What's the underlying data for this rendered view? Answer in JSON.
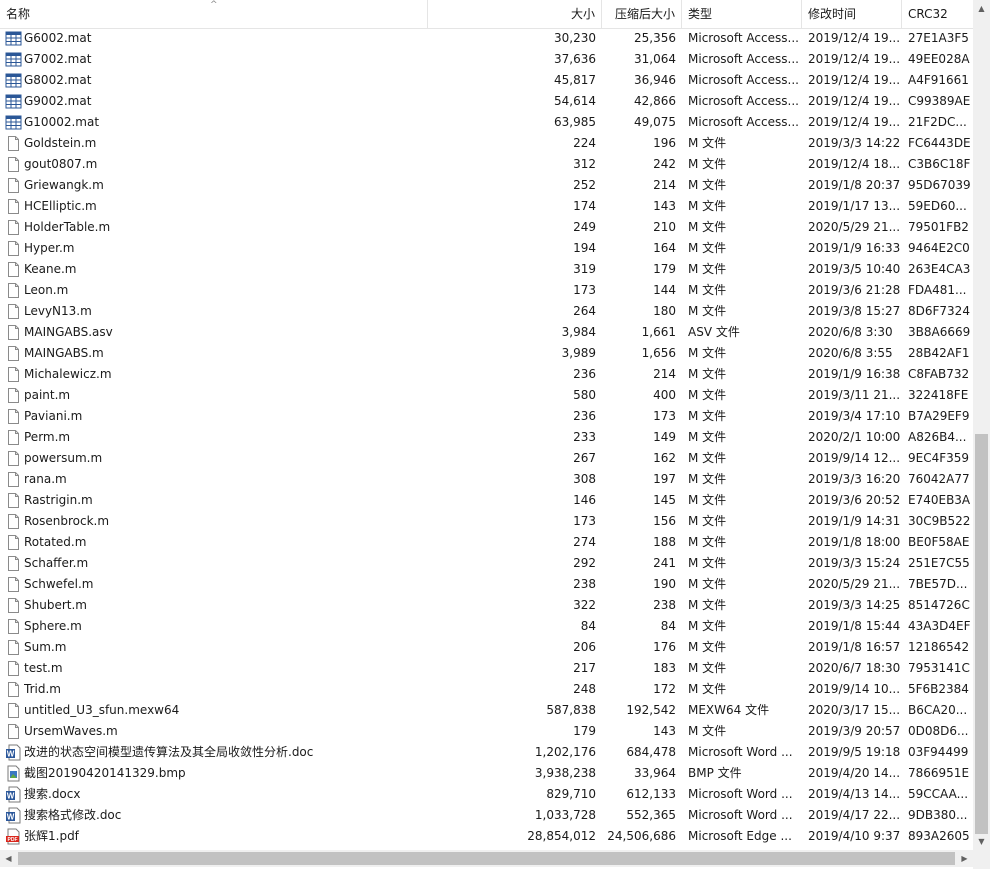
{
  "columns": {
    "name": "名称",
    "size": "大小",
    "compressed": "压缩后大小",
    "type": "类型",
    "modified": "修改时间",
    "crc": "CRC32"
  },
  "icons": {
    "scroll_up": "▲",
    "scroll_down": "▼",
    "scroll_left": "◀",
    "scroll_right": "▶",
    "sort": "^"
  },
  "files": [
    {
      "name": "G6002.mat",
      "size": "30,230",
      "compressed": "25,356",
      "type": "Microsoft Access...",
      "modified": "2019/12/4 19...",
      "crc": "27E1A3F5",
      "icon": "access-table-icon"
    },
    {
      "name": "G7002.mat",
      "size": "37,636",
      "compressed": "31,064",
      "type": "Microsoft Access...",
      "modified": "2019/12/4 19...",
      "crc": "49EE028A",
      "icon": "access-table-icon"
    },
    {
      "name": "G8002.mat",
      "size": "45,817",
      "compressed": "36,946",
      "type": "Microsoft Access...",
      "modified": "2019/12/4 19...",
      "crc": "A4F91661",
      "icon": "access-table-icon"
    },
    {
      "name": "G9002.mat",
      "size": "54,614",
      "compressed": "42,866",
      "type": "Microsoft Access...",
      "modified": "2019/12/4 19...",
      "crc": "C99389AE",
      "icon": "access-table-icon"
    },
    {
      "name": "G10002.mat",
      "size": "63,985",
      "compressed": "49,075",
      "type": "Microsoft Access...",
      "modified": "2019/12/4 19...",
      "crc": "21F2DC...",
      "icon": "access-table-icon"
    },
    {
      "name": "Goldstein.m",
      "size": "224",
      "compressed": "196",
      "type": "M 文件",
      "modified": "2019/3/3 14:22",
      "crc": "FC6443DE",
      "icon": "file-icon"
    },
    {
      "name": "gout0807.m",
      "size": "312",
      "compressed": "242",
      "type": "M 文件",
      "modified": "2019/12/4 18...",
      "crc": "C3B6C18F",
      "icon": "file-icon"
    },
    {
      "name": "Griewangk.m",
      "size": "252",
      "compressed": "214",
      "type": "M 文件",
      "modified": "2019/1/8 20:37",
      "crc": "95D67039",
      "icon": "file-icon"
    },
    {
      "name": "HCElliptic.m",
      "size": "174",
      "compressed": "143",
      "type": "M 文件",
      "modified": "2019/1/17 13...",
      "crc": "59ED60...",
      "icon": "file-icon"
    },
    {
      "name": "HolderTable.m",
      "size": "249",
      "compressed": "210",
      "type": "M 文件",
      "modified": "2020/5/29 21...",
      "crc": "79501FB2",
      "icon": "file-icon"
    },
    {
      "name": "Hyper.m",
      "size": "194",
      "compressed": "164",
      "type": "M 文件",
      "modified": "2019/1/9 16:33",
      "crc": "9464E2C0",
      "icon": "file-icon"
    },
    {
      "name": "Keane.m",
      "size": "319",
      "compressed": "179",
      "type": "M 文件",
      "modified": "2019/3/5 10:40",
      "crc": "263E4CA3",
      "icon": "file-icon"
    },
    {
      "name": "Leon.m",
      "size": "173",
      "compressed": "144",
      "type": "M 文件",
      "modified": "2019/3/6 21:28",
      "crc": "FDA481...",
      "icon": "file-icon"
    },
    {
      "name": "LevyN13.m",
      "size": "264",
      "compressed": "180",
      "type": "M 文件",
      "modified": "2019/3/8 15:27",
      "crc": "8D6F7324",
      "icon": "file-icon"
    },
    {
      "name": "MAINGABS.asv",
      "size": "3,984",
      "compressed": "1,661",
      "type": "ASV 文件",
      "modified": "2020/6/8 3:30",
      "crc": "3B8A6669",
      "icon": "file-icon"
    },
    {
      "name": "MAINGABS.m",
      "size": "3,989",
      "compressed": "1,656",
      "type": "M 文件",
      "modified": "2020/6/8 3:55",
      "crc": "28B42AF1",
      "icon": "file-icon"
    },
    {
      "name": "Michalewicz.m",
      "size": "236",
      "compressed": "214",
      "type": "M 文件",
      "modified": "2019/1/9 16:38",
      "crc": "C8FAB732",
      "icon": "file-icon"
    },
    {
      "name": "paint.m",
      "size": "580",
      "compressed": "400",
      "type": "M 文件",
      "modified": "2019/3/11 21...",
      "crc": "322418FE",
      "icon": "file-icon"
    },
    {
      "name": "Paviani.m",
      "size": "236",
      "compressed": "173",
      "type": "M 文件",
      "modified": "2019/3/4 17:10",
      "crc": "B7A29EF9",
      "icon": "file-icon"
    },
    {
      "name": "Perm.m",
      "size": "233",
      "compressed": "149",
      "type": "M 文件",
      "modified": "2020/2/1 10:00",
      "crc": "A826B4...",
      "icon": "file-icon"
    },
    {
      "name": "powersum.m",
      "size": "267",
      "compressed": "162",
      "type": "M 文件",
      "modified": "2019/9/14 12...",
      "crc": "9EC4F359",
      "icon": "file-icon"
    },
    {
      "name": "rana.m",
      "size": "308",
      "compressed": "197",
      "type": "M 文件",
      "modified": "2019/3/3 16:20",
      "crc": "76042A77",
      "icon": "file-icon"
    },
    {
      "name": "Rastrigin.m",
      "size": "146",
      "compressed": "145",
      "type": "M 文件",
      "modified": "2019/3/6 20:52",
      "crc": "E740EB3A",
      "icon": "file-icon"
    },
    {
      "name": "Rosenbrock.m",
      "size": "173",
      "compressed": "156",
      "type": "M 文件",
      "modified": "2019/1/9 14:31",
      "crc": "30C9B522",
      "icon": "file-icon"
    },
    {
      "name": "Rotated.m",
      "size": "274",
      "compressed": "188",
      "type": "M 文件",
      "modified": "2019/1/8 18:00",
      "crc": "BE0F58AE",
      "icon": "file-icon"
    },
    {
      "name": "Schaffer.m",
      "size": "292",
      "compressed": "241",
      "type": "M 文件",
      "modified": "2019/3/3 15:24",
      "crc": "251E7C55",
      "icon": "file-icon"
    },
    {
      "name": "Schwefel.m",
      "size": "238",
      "compressed": "190",
      "type": "M 文件",
      "modified": "2020/5/29 21...",
      "crc": "7BE57D...",
      "icon": "file-icon"
    },
    {
      "name": "Shubert.m",
      "size": "322",
      "compressed": "238",
      "type": "M 文件",
      "modified": "2019/3/3 14:25",
      "crc": "8514726C",
      "icon": "file-icon"
    },
    {
      "name": "Sphere.m",
      "size": "84",
      "compressed": "84",
      "type": "M 文件",
      "modified": "2019/1/8 15:44",
      "crc": "43A3D4EF",
      "icon": "file-icon"
    },
    {
      "name": "Sum.m",
      "size": "206",
      "compressed": "176",
      "type": "M 文件",
      "modified": "2019/1/8 16:57",
      "crc": "12186542",
      "icon": "file-icon"
    },
    {
      "name": "test.m",
      "size": "217",
      "compressed": "183",
      "type": "M 文件",
      "modified": "2020/6/7 18:30",
      "crc": "7953141C",
      "icon": "file-icon"
    },
    {
      "name": "Trid.m",
      "size": "248",
      "compressed": "172",
      "type": "M 文件",
      "modified": "2019/9/14 10...",
      "crc": "5F6B2384",
      "icon": "file-icon"
    },
    {
      "name": "untitled_U3_sfun.mexw64",
      "size": "587,838",
      "compressed": "192,542",
      "type": "MEXW64 文件",
      "modified": "2020/3/17 15...",
      "crc": "B6CA20...",
      "icon": "file-icon"
    },
    {
      "name": "UrsemWaves.m",
      "size": "179",
      "compressed": "143",
      "type": "M 文件",
      "modified": "2019/3/9 20:57",
      "crc": "0D08D6...",
      "icon": "file-icon"
    },
    {
      "name": "改进的状态空间模型遗传算法及其全局收敛性分析.doc",
      "size": "1,202,176",
      "compressed": "684,478",
      "type": "Microsoft Word ...",
      "modified": "2019/9/5 19:18",
      "crc": "03F94499",
      "icon": "word-doc-icon"
    },
    {
      "name": "截图20190420141329.bmp",
      "size": "3,938,238",
      "compressed": "33,964",
      "type": "BMP 文件",
      "modified": "2019/4/20 14...",
      "crc": "7866951E",
      "icon": "bitmap-image-icon"
    },
    {
      "name": "搜索.docx",
      "size": "829,710",
      "compressed": "612,133",
      "type": "Microsoft Word ...",
      "modified": "2019/4/13 14...",
      "crc": "59CCAA...",
      "icon": "word-docx-icon"
    },
    {
      "name": "搜索格式修改.doc",
      "size": "1,033,728",
      "compressed": "552,365",
      "type": "Microsoft Word ...",
      "modified": "2019/4/17 22...",
      "crc": "9DB380...",
      "icon": "word-doc-icon"
    },
    {
      "name": "张辉1.pdf",
      "size": "28,854,012",
      "compressed": "24,506,686",
      "type": "Microsoft Edge ...",
      "modified": "2019/4/10 9:37",
      "crc": "893A2605",
      "icon": "pdf-icon"
    }
  ]
}
